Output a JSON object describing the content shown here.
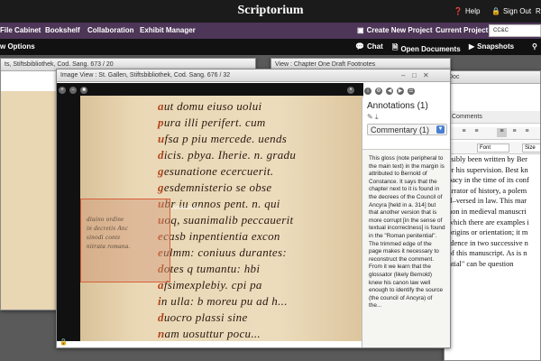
{
  "app": {
    "brand": "Scriptorium"
  },
  "top_links": {
    "help": "Help",
    "sign_out": "Sign Out",
    "cut": "R"
  },
  "nav": {
    "items": [
      "File Cabinet",
      "Bookshelf",
      "Collaboration",
      "Exhibit Manager"
    ],
    "create_project": "Create New Project",
    "current_project_label": "Current Project:",
    "current_project_value": "CC&C"
  },
  "toolbar": {
    "view_options": "w Options",
    "chat": "Chat",
    "open_documents": "Open Documents",
    "snapshots": "Snapshots"
  },
  "back_window": {
    "title": "ts, Stiftsbibliothek, Cod. Sang. 673 / 20"
  },
  "draft_window": {
    "title": "View : Chapter One Draft Footnotes"
  },
  "doc_window": {
    "title": "Doc"
  },
  "image_view": {
    "title": "Image View : St. Gallen, Stiftsbibliothek, Cod. Sang. 676 / 32",
    "annotation_label": "Annotations",
    "ms_lines": [
      "aut domu eiuso uolui",
      "pura illi perifert. cum",
      "ufsa p piu mercede. uends",
      "dicis. pbya. Iherie. n. gradu",
      "gesunatione ecercuerit.",
      "gesdemnisterio se obse",
      "ubr iu annos pent. n. qui",
      "uoq, suanimalib peccauerit",
      "ecasb inpentientia excon",
      "eulmm: coniuus durantes:",
      "dotes q tumantu: hbi",
      "afsimexplebiy. cpi pa",
      "in ulla: b moreu pu ad h...",
      "duocro plassi sine",
      "nam uosuttur pocu..."
    ],
    "gloss_lines": [
      "diuino ordine",
      "in decretis Anc",
      "sinodi conte",
      "nitrata romana."
    ]
  },
  "annotations": {
    "title": "Annotations (1)",
    "category": "Commentary (1)",
    "body": "This gloss (note peripheral to the main text) in the margin is attributed to Bernold of Constance. It says that the chapter next to it is found in the decrees of the Council of Ancyra [held in a. 314] but that another version that is more corrupt [in the sense of textual incorrectness] is found in the \"Roman penitential\". The trimmed edge of the page makes it necessary to reconstruct the comment. From it we learn that the glossator (likely Bernold) knew his canon law well enough to identify the source (the council of Ancyra) of the..."
  },
  "editor": {
    "comments_label": "Comments",
    "font_label": "Font",
    "size_label": "Size",
    "lines": [
      "ssibly been written by Ber",
      "er his supervision.  Best kn",
      "pacy in the time of its conf",
      "arrator of history, a polem",
      "ll–versed in law.  This mar",
      "non in medieval manuscri",
      "which there are examples i",
      "origins or orientation; it m",
      "idence in two successive n",
      "of this manuscript.  As is n",
      "ntial\" can be question"
    ]
  }
}
